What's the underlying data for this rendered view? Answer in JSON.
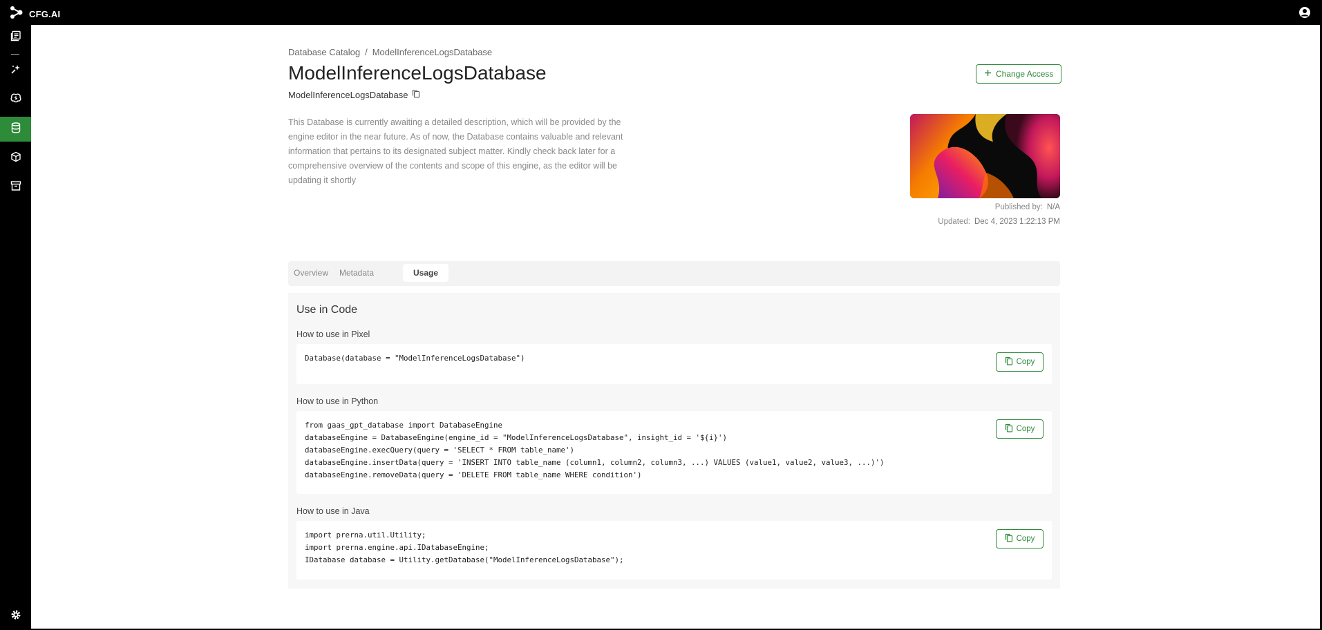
{
  "app": {
    "name": "CFG.AI"
  },
  "breadcrumb": {
    "root": "Database Catalog",
    "separator": "/",
    "current": "ModelInferenceLogsDatabase"
  },
  "page": {
    "title": "ModelInferenceLogsDatabase",
    "id": "ModelInferenceLogsDatabase",
    "description": "This Database is currently awaiting a detailed description, which will be provided by the engine editor in the near future. As of now, the Database contains valuable and relevant information that pertains to its designated subject matter. Kindly check back later for a comprehensive overview of the contents and scope of this engine, as the editor will be updating it shortly",
    "change_access_label": "Change Access",
    "published_by_label": "Published by:",
    "published_by_value": "N/A",
    "updated_label": "Updated:",
    "updated_value": "Dec 4, 2023 1:22:13 PM"
  },
  "tabs": [
    {
      "label": "Overview"
    },
    {
      "label": "Metadata"
    },
    {
      "label": "Usage"
    }
  ],
  "usage": {
    "title": "Use in Code",
    "copy_label": "Copy",
    "pixel": {
      "label": "How to use in Pixel",
      "code": "Database(database = \"ModelInferenceLogsDatabase\")"
    },
    "python": {
      "label": "How to use in Python",
      "code": "from gaas_gpt_database import DatabaseEngine\ndatabaseEngine = DatabaseEngine(engine_id = \"ModelInferenceLogsDatabase\", insight_id = '${i}')\ndatabaseEngine.execQuery(query = 'SELECT * FROM table_name')\ndatabaseEngine.insertData(query = 'INSERT INTO table_name (column1, column2, column3, ...) VALUES (value1, value2, value3, ...)')\ndatabaseEngine.removeData(query = 'DELETE FROM table_name WHERE condition')"
    },
    "java": {
      "label": "How to use in Java",
      "code": "import prerna.util.Utility;\nimport prerna.engine.api.IDatabaseEngine;\nIDatabase database = Utility.getDatabase(\"ModelInferenceLogsDatabase\");"
    }
  },
  "colors": {
    "accent": "#2e8b3a",
    "topbar": "#000000"
  }
}
